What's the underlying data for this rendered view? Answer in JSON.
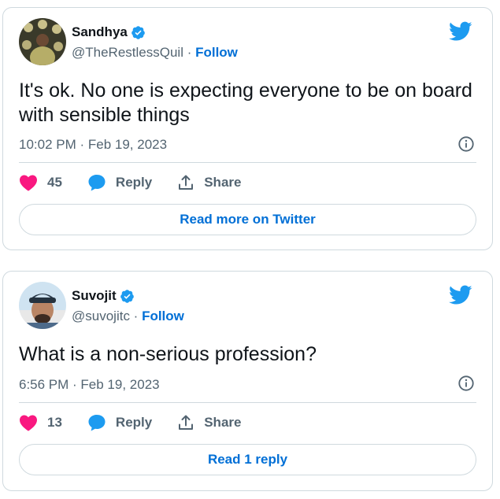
{
  "tweets": [
    {
      "name": "Sandhya",
      "handle": "@TheRestlessQuil",
      "separator": " · ",
      "follow": "Follow",
      "text": "It's ok. No one is expecting everyone to be on board with sensible things",
      "timestamp": "10:02 PM · Feb 19, 2023",
      "likes": "45",
      "reply_label": "Reply",
      "share_label": "Share",
      "cta": "Read more on Twitter"
    },
    {
      "name": "Suvojit",
      "handle": "@suvojitc",
      "separator": " · ",
      "follow": "Follow",
      "text": "What is a non-serious profession?",
      "timestamp": "6:56 PM · Feb 19, 2023",
      "likes": "13",
      "reply_label": "Reply",
      "share_label": "Share",
      "cta": "Read 1 reply"
    }
  ],
  "colors": {
    "like": "#f91880",
    "link": "#006fd6",
    "twitter_blue": "#1d9bf0",
    "muted": "#536471"
  },
  "icons": [
    "verified-badge-icon",
    "twitter-bird-icon",
    "info-icon",
    "heart-icon",
    "reply-bubble-icon",
    "share-icon"
  ]
}
